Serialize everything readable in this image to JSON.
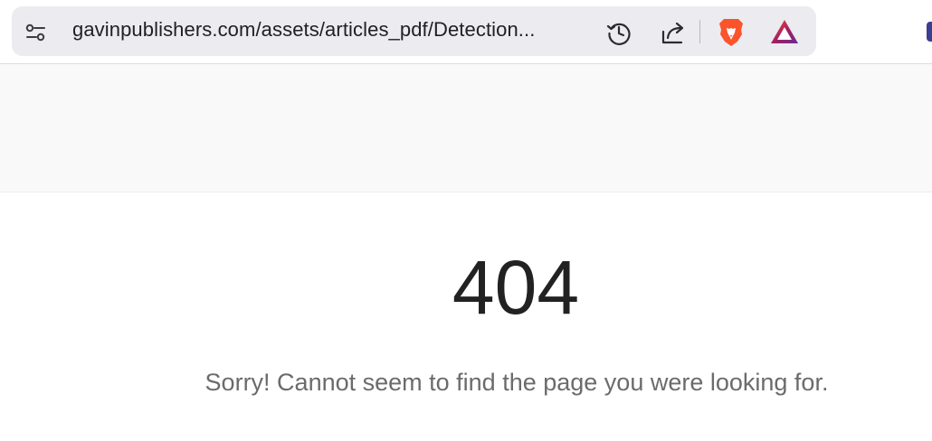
{
  "browser": {
    "address_bar": {
      "url": "gavinpublishers.com/assets/articles_pdf/Detection...",
      "site_info_icon": "tune-icon",
      "history_icon": "history-icon",
      "share_icon": "share-icon"
    },
    "extensions": {
      "brave_shields_icon": "brave-lion-icon",
      "brave_rewards_icon": "brave-rewards-triangle-icon",
      "brand_orange": "#fb542b",
      "rewards_gradient": [
        "#ff4724",
        "#9e1f63",
        "#662d91"
      ]
    }
  },
  "page": {
    "error_code": "404",
    "error_message": "Sorry! Cannot seem to find the page you were looking for."
  }
}
